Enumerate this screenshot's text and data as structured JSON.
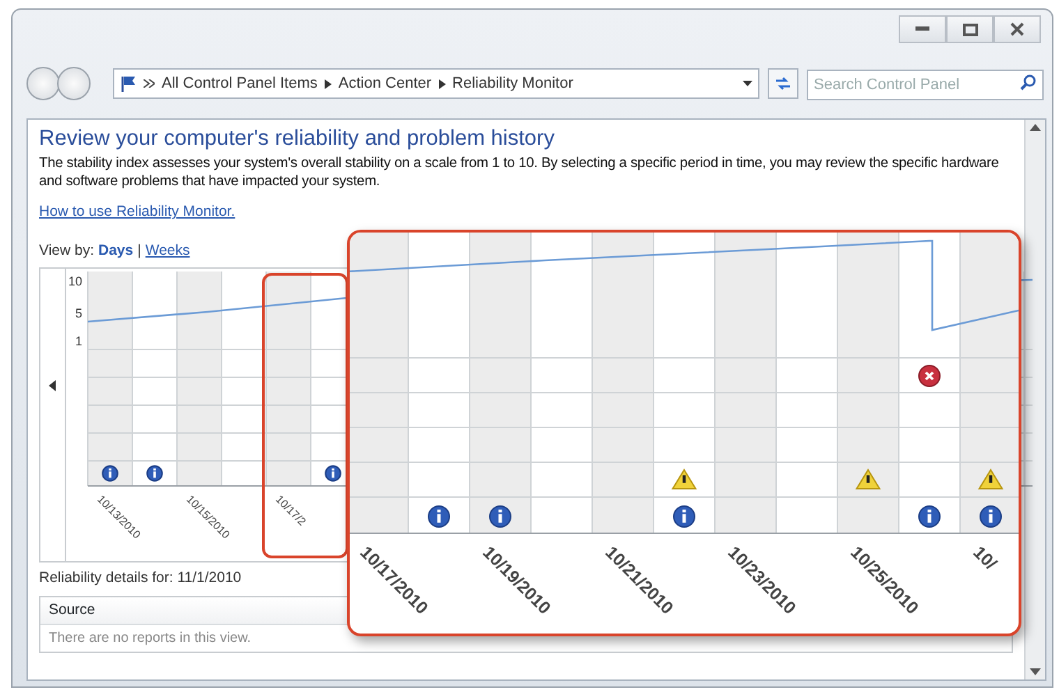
{
  "address_bar": {
    "breadcrumbs": [
      "All Control Panel Items",
      "Action Center",
      "Reliability Monitor"
    ]
  },
  "search": {
    "placeholder": "Search Control Panel"
  },
  "page": {
    "heading": "Review your computer's reliability and problem history",
    "description": "The stability index assesses your system's overall stability on a scale from 1 to 10. By selecting a specific period in time, you may review the specific hardware and software problems that have impacted your system.",
    "help_link": "How to use Reliability Monitor.",
    "view_by": {
      "label": "View by:",
      "separator": "|",
      "options": [
        {
          "label": "Days",
          "selected": true
        },
        {
          "label": "Weeks",
          "selected": false
        }
      ]
    }
  },
  "chart": {
    "y_labels": [
      "10",
      "5",
      "1"
    ],
    "columns": [
      {
        "date": "10/13/2010",
        "events": [
          {
            "kind": "info"
          }
        ]
      },
      {
        "events": [
          {
            "kind": "info"
          }
        ]
      },
      {
        "date": "10/15/2010"
      },
      {},
      {
        "date": "10/17/2"
      },
      {
        "events": [
          {
            "kind": "info"
          }
        ]
      }
    ]
  },
  "callout": {
    "columns": [
      {
        "date": "10/17/2010"
      },
      {
        "events": [
          {
            "kind": "info"
          }
        ]
      },
      {
        "date": "10/19/2010",
        "events": [
          {
            "kind": "info"
          }
        ]
      },
      {},
      {
        "date": "10/21/2010"
      },
      {
        "events": [
          {
            "kind": "warning"
          },
          {
            "kind": "info"
          }
        ]
      },
      {
        "date": "10/23/2010"
      },
      {},
      {
        "date": "10/25/2010",
        "events": [
          {
            "kind": "warning"
          }
        ]
      },
      {
        "events": [
          {
            "kind": "error"
          },
          {
            "kind": "info"
          }
        ]
      },
      {
        "date": "10/",
        "events": [
          {
            "kind": "warning"
          },
          {
            "kind": "info"
          }
        ]
      }
    ]
  },
  "details": {
    "title": "Reliability details for: 11/1/2010",
    "columns": [
      "Source"
    ],
    "empty_message": "There are no reports in this view."
  }
}
